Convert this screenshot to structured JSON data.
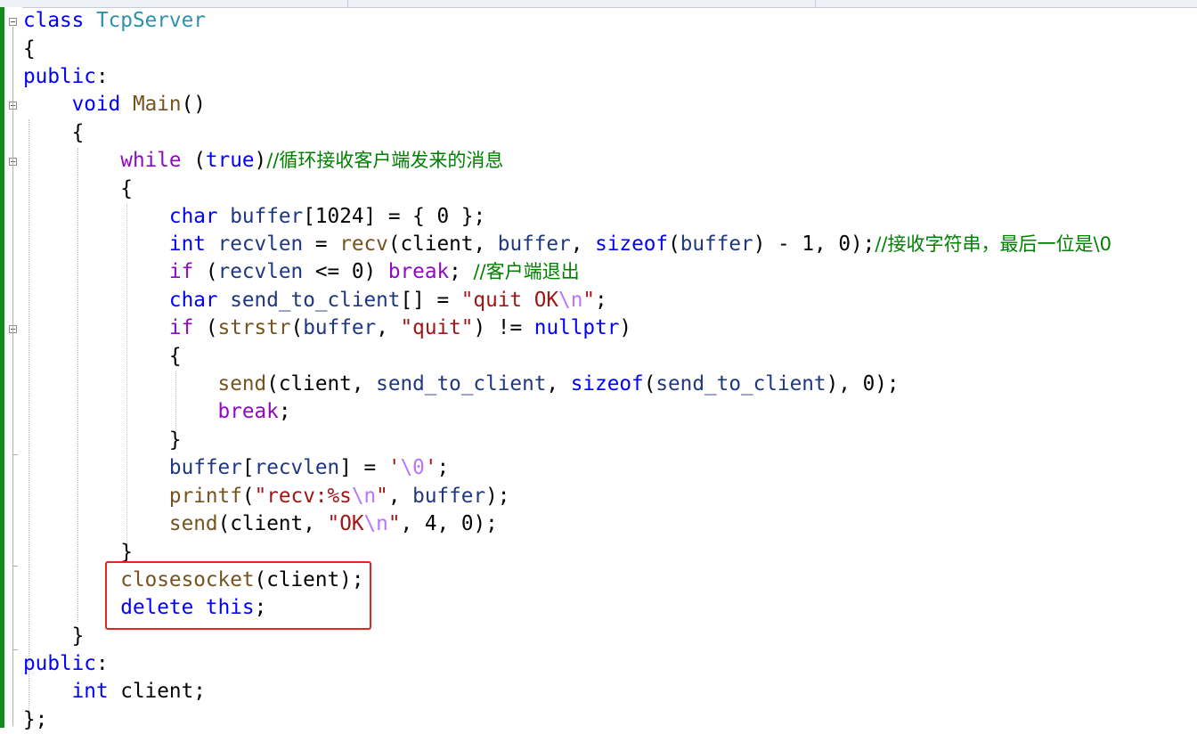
{
  "editor": {
    "language": "C++",
    "highlight_color": "#e5251d",
    "change_bar_color": "#108d1c",
    "code_lines": [
      "class TcpServer",
      "{",
      "public:",
      "    void Main()",
      "    {",
      "        while (true)//循环接收客户端发来的消息",
      "        {",
      "            char buffer[1024] = { 0 };",
      "            int recvlen = recv(client, buffer, sizeof(buffer) - 1, 0);//接收字符串，最后一位是\\0",
      "            if (recvlen <= 0) break; //客户端退出",
      "            char send_to_client[] = \"quit OK\\n\";",
      "            if (strstr(buffer, \"quit\") != nullptr)",
      "            {",
      "                send(client, send_to_client, sizeof(send_to_client), 0);",
      "                break;",
      "            }",
      "            buffer[recvlen] = '\\0';",
      "            printf(\"recv:%s\\n\", buffer);",
      "            send(client, \"OK\\n\", 4, 0);",
      "        }",
      "        closesocket(client);",
      "        delete this;",
      "    }",
      "public:",
      "    int client;",
      "};"
    ],
    "tokens": {
      "l0": [
        "class",
        " ",
        "TcpServer"
      ],
      "l1": [
        "{"
      ],
      "l2": [
        "public",
        ":"
      ],
      "l3": [
        "    ",
        "void",
        " ",
        "Main",
        "()"
      ],
      "l4": [
        "    {"
      ],
      "l5": [
        "        ",
        "while",
        " (",
        "true",
        ")",
        "//循环接收客户端发来的消息"
      ],
      "l6": [
        "        {"
      ],
      "l7": [
        "            ",
        "char",
        " ",
        "buffer",
        "[",
        "1024",
        "] = { ",
        "0",
        " };"
      ],
      "l8": [
        "            ",
        "int",
        " ",
        "recvlen",
        " = ",
        "recv",
        "(",
        "client",
        ", ",
        "buffer",
        ", ",
        "sizeof",
        "(",
        "buffer",
        ") - ",
        "1",
        ", ",
        "0",
        ");",
        "//接收字符串，最后一位是\\0"
      ],
      "l9": [
        "            ",
        "if",
        " (",
        "recvlen",
        " <= ",
        "0",
        ") ",
        "break",
        "; ",
        "//客户端退出"
      ],
      "l10": [
        "            ",
        "char",
        " ",
        "send_to_client",
        "[] = ",
        "\"quit OK",
        "\\n",
        "\"",
        ";"
      ],
      "l11": [
        "            ",
        "if",
        " (",
        "strstr",
        "(",
        "buffer",
        ", ",
        "\"quit\"",
        ") != ",
        "nullptr",
        ")"
      ],
      "l12": [
        "            {"
      ],
      "l13": [
        "                ",
        "send",
        "(",
        "client",
        ", ",
        "send_to_client",
        ", ",
        "sizeof",
        "(",
        "send_to_client",
        "), ",
        "0",
        ");"
      ],
      "l14": [
        "                ",
        "break",
        ";"
      ],
      "l15": [
        "            }"
      ],
      "l16": [
        "            ",
        "buffer",
        "[",
        "recvlen",
        "] = ",
        "'",
        "\\0",
        "'",
        ";"
      ],
      "l17": [
        "            ",
        "printf",
        "(",
        "\"recv:%s",
        "\\n",
        "\"",
        ", ",
        "buffer",
        ");"
      ],
      "l18": [
        "            ",
        "send",
        "(",
        "client",
        ", ",
        "\"OK",
        "\\n",
        "\"",
        ", ",
        "4",
        ", ",
        "0",
        ");"
      ],
      "l19": [
        "        }"
      ],
      "l20": [
        "        ",
        "closesocket",
        "(",
        "client",
        ");"
      ],
      "l21": [
        "        ",
        "delete",
        " ",
        "this",
        ";"
      ],
      "l22": [
        "    }"
      ],
      "l23": [
        "public",
        ":"
      ],
      "l24": [
        "    ",
        "int",
        " ",
        "client",
        ";"
      ],
      "l25": [
        "};"
      ]
    }
  }
}
